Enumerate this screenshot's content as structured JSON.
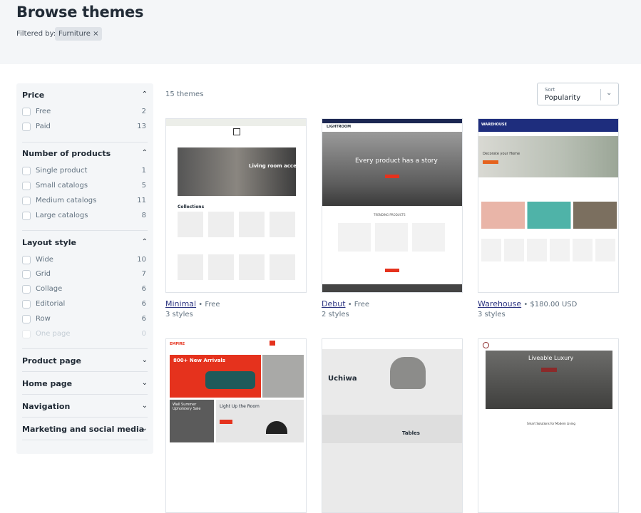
{
  "header": {
    "title": "Browse themes",
    "filtered_by": "Filtered by:",
    "filter_chip": "Furniture ×"
  },
  "sidebar": {
    "sections": [
      {
        "title": "Price",
        "expanded": true,
        "options": [
          {
            "label": "Free",
            "count": "2"
          },
          {
            "label": "Paid",
            "count": "13"
          }
        ]
      },
      {
        "title": "Number of products",
        "expanded": true,
        "options": [
          {
            "label": "Single product",
            "count": "1"
          },
          {
            "label": "Small catalogs",
            "count": "5"
          },
          {
            "label": "Medium catalogs",
            "count": "11"
          },
          {
            "label": "Large catalogs",
            "count": "8"
          }
        ]
      },
      {
        "title": "Layout style",
        "expanded": true,
        "options": [
          {
            "label": "Wide",
            "count": "10"
          },
          {
            "label": "Grid",
            "count": "7"
          },
          {
            "label": "Collage",
            "count": "6"
          },
          {
            "label": "Editorial",
            "count": "6"
          },
          {
            "label": "Row",
            "count": "6"
          },
          {
            "label": "One page",
            "count": "0",
            "disabled": true
          }
        ]
      },
      {
        "title": "Product page",
        "expanded": false
      },
      {
        "title": "Home page",
        "expanded": false
      },
      {
        "title": "Navigation",
        "expanded": false
      },
      {
        "title": "Marketing and social media",
        "expanded": false
      }
    ]
  },
  "results": {
    "count": "15 themes",
    "sort_label": "Sort",
    "sort_value": "Popularity"
  },
  "themes": [
    {
      "name": "Minimal",
      "price": "Free",
      "styles": "3 styles",
      "preview": {
        "hero": "Living room accents",
        "section": "Collections"
      }
    },
    {
      "name": "Debut",
      "price": "Free",
      "styles": "2 styles",
      "preview": {
        "brand": "LIGHTROOM",
        "hero": "Every product has a story",
        "section": "TRENDING PRODUCTS"
      }
    },
    {
      "name": "Warehouse",
      "price": "$180.00 USD",
      "styles": "3 styles",
      "preview": {
        "brand": "WAREHOUSE",
        "hero": "Decorate your Home"
      }
    },
    {
      "name": "",
      "price": "",
      "styles": "",
      "preview": {
        "brand": "EMPIRE",
        "hero": "800+ New Arrivals",
        "hero2": "Light Up the Room",
        "hero3": "Wall Summer Upholstery Sale"
      }
    },
    {
      "name": "",
      "price": "",
      "styles": "",
      "preview": {
        "hero": "Uchiwa",
        "section": "Tables"
      }
    },
    {
      "name": "",
      "price": "",
      "styles": "",
      "preview": {
        "hero": "Liveable Luxury",
        "section": "Smart Solutions for Modern Living"
      }
    }
  ],
  "colors": {
    "link": "#2c3481",
    "header_bg": "#f4f6f8",
    "accent_red": "#e5321d"
  }
}
